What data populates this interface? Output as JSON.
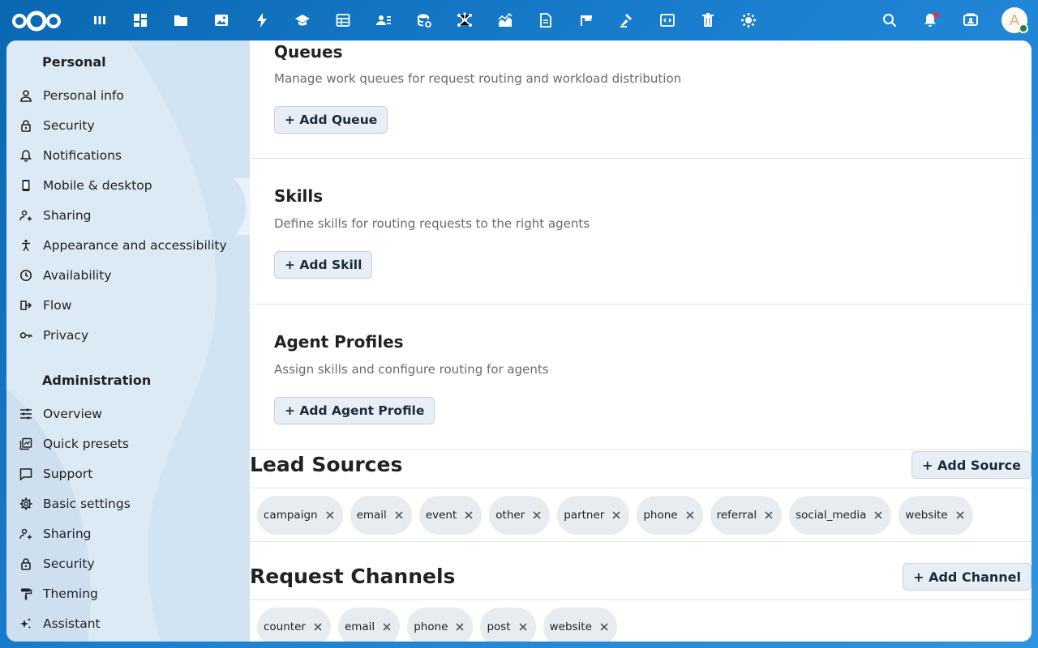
{
  "topbar": {
    "apps": [
      {
        "name": "dashboard-icon"
      },
      {
        "name": "grid-icon"
      },
      {
        "name": "files-icon"
      },
      {
        "name": "photos-icon"
      },
      {
        "name": "activity-icon"
      },
      {
        "name": "learn-icon"
      },
      {
        "name": "tables-icon"
      },
      {
        "name": "contacts-icon"
      },
      {
        "name": "database-icon"
      },
      {
        "name": "network-icon"
      },
      {
        "name": "analytics-icon"
      },
      {
        "name": "document-icon"
      },
      {
        "name": "flag-icon"
      },
      {
        "name": "tools-icon"
      },
      {
        "name": "code-icon"
      },
      {
        "name": "trash-icon"
      },
      {
        "name": "settings-gear-icon"
      }
    ],
    "avatar_letter": "A"
  },
  "sidebar": {
    "personal_heading": "Personal",
    "personal_items": [
      {
        "label": "Personal info",
        "icon": "person-icon"
      },
      {
        "label": "Security",
        "icon": "lock-icon"
      },
      {
        "label": "Notifications",
        "icon": "bell-icon"
      },
      {
        "label": "Mobile & desktop",
        "icon": "phone-icon"
      },
      {
        "label": "Sharing",
        "icon": "share-icon"
      },
      {
        "label": "Appearance and accessibility",
        "icon": "accessibility-icon"
      },
      {
        "label": "Availability",
        "icon": "clock-icon"
      },
      {
        "label": "Flow",
        "icon": "flow-icon"
      },
      {
        "label": "Privacy",
        "icon": "key-icon"
      }
    ],
    "admin_heading": "Administration",
    "admin_items": [
      {
        "label": "Overview",
        "icon": "sliders-icon"
      },
      {
        "label": "Quick presets",
        "icon": "presets-icon"
      },
      {
        "label": "Support",
        "icon": "chat-icon"
      },
      {
        "label": "Basic settings",
        "icon": "gear-icon"
      },
      {
        "label": "Sharing",
        "icon": "share-icon"
      },
      {
        "label": "Security",
        "icon": "lock-icon"
      },
      {
        "label": "Theming",
        "icon": "paint-roller-icon"
      },
      {
        "label": "Assistant",
        "icon": "sparkle-icon"
      }
    ]
  },
  "main": {
    "queues": {
      "title": "Queues",
      "description": "Manage work queues for request routing and workload distribution",
      "button": "+ Add Queue"
    },
    "skills": {
      "title": "Skills",
      "description": "Define skills for routing requests to the right agents",
      "button": "+ Add Skill"
    },
    "agents": {
      "title": "Agent Profiles",
      "description": "Assign skills and configure routing for agents",
      "button": "+ Add Agent Profile"
    },
    "lead_sources": {
      "title": "Lead Sources",
      "button": "+ Add Source",
      "tags": [
        "campaign",
        "email",
        "event",
        "other",
        "partner",
        "phone",
        "referral",
        "social_media",
        "website"
      ]
    },
    "request_channels": {
      "title": "Request Channels",
      "button": "+ Add Channel",
      "tags": [
        "counter",
        "email",
        "phone",
        "post",
        "website"
      ]
    }
  }
}
